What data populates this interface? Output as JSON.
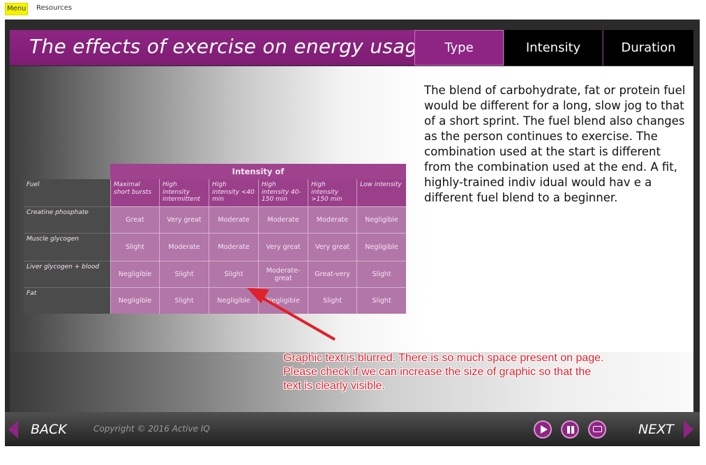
{
  "topbar": {
    "menu_label": "Menu",
    "resources_label": "Resources"
  },
  "header": {
    "title": "The effects of exercise on energy usage",
    "tabs": [
      {
        "label": "Type"
      },
      {
        "label": "Intensity"
      },
      {
        "label": "Duration"
      }
    ]
  },
  "body_text": "The blend of carbohydrate, fat or protein fuel would be different for a long, slow jog to that of a short sprint. The fuel blend also changes as the person continues to exercise. The combination used at the start is different from the combination used at the end. A fit, highly-trained indiv idual would hav e a different fuel blend to a beginner.",
  "table": {
    "top_header": "Intensity of",
    "fuel_label": "Fuel",
    "columns": [
      "Maximal short bursts",
      "High intensity intermittent",
      "High intensity <40 min",
      "High intensity 40-150 min",
      "High intensity >150 min",
      "Low intensity"
    ],
    "rows": [
      {
        "fuel": "Creatine phosphate",
        "cells": [
          "Great",
          "Very great",
          "Moderate",
          "Moderate",
          "Moderate",
          "Negligible"
        ]
      },
      {
        "fuel": "Muscle glycogen",
        "cells": [
          "Slight",
          "Moderate",
          "Moderate",
          "Very great",
          "Very great",
          "Negligible"
        ]
      },
      {
        "fuel": "Liver glycogen + blood",
        "cells": [
          "Negligible",
          "Slight",
          "Slight",
          "Moderate-great",
          "Great-very",
          "Slight"
        ]
      },
      {
        "fuel": "Fat",
        "cells": [
          "Negligible",
          "Slight",
          "Negligible",
          "Negligible",
          "Slight",
          "Slight"
        ]
      }
    ]
  },
  "annotation": {
    "text": "Graphic text is blurred. There is so much space present on page. Please check if we can increase the size of graphic so that the text is clearly visible.",
    "color": "#e0202a"
  },
  "footer": {
    "back_label": "BACK",
    "next_label": "NEXT",
    "copyright": "Copyright © 2016 Active IQ",
    "controls": [
      "play-icon",
      "pause-icon",
      "chat-icon"
    ]
  },
  "colors": {
    "accent": "#8e2483"
  }
}
